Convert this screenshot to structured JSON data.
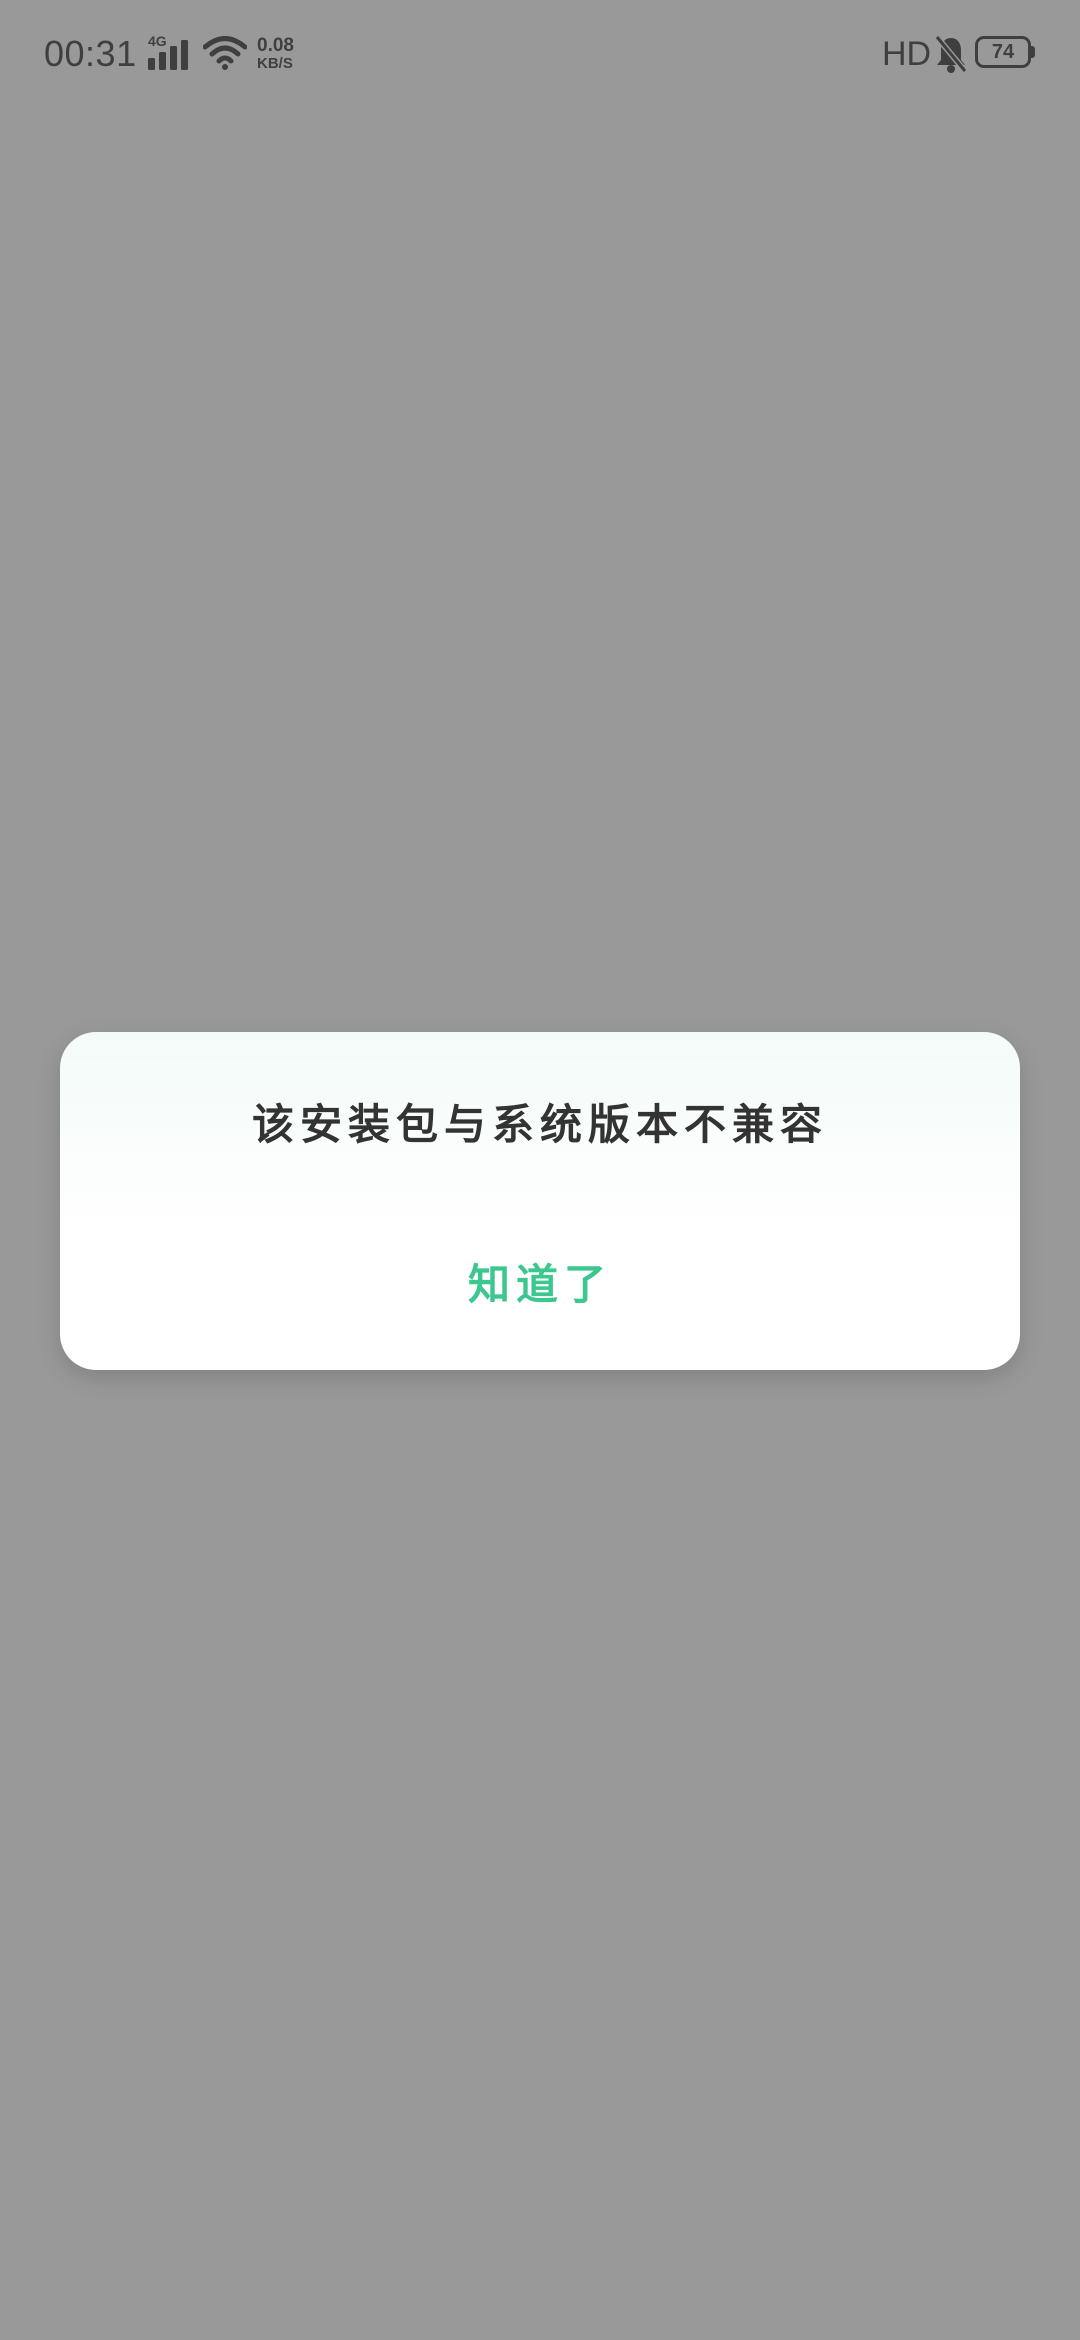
{
  "status_bar": {
    "time": "00:31",
    "network_type": "4G",
    "speed_value": "0.08",
    "speed_unit": "KB/S",
    "hd_label": "HD",
    "battery_level": "74",
    "icons": [
      "signal-icon",
      "wifi-icon",
      "bell-muted-icon",
      "battery-icon"
    ]
  },
  "dialog": {
    "message": "该安装包与系统版本不兼容",
    "confirm_label": "知道了"
  },
  "colors": {
    "overlay": "#999999",
    "accent": "#3cc78f",
    "text": "#333333"
  }
}
